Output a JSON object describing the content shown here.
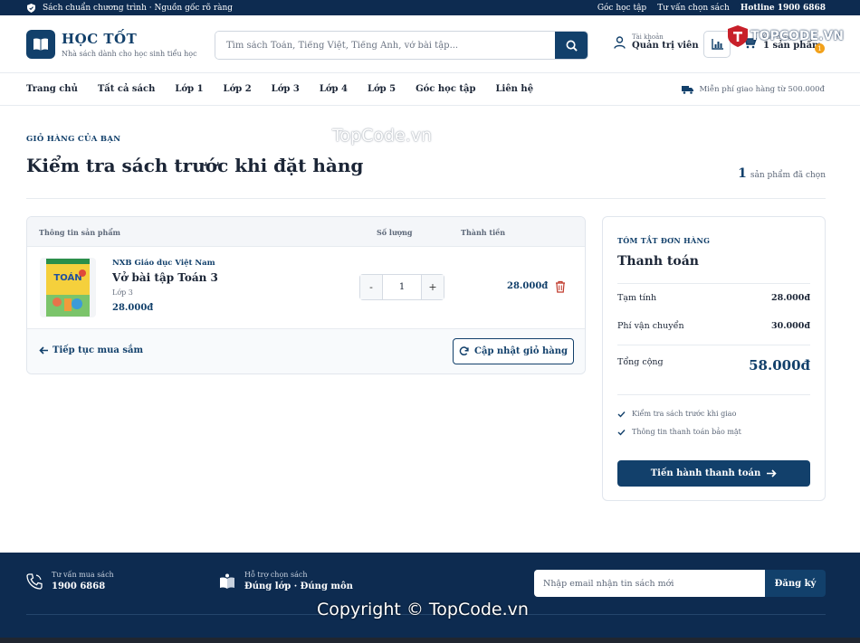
{
  "topbar": {
    "tagline": "Sách chuẩn chương trình · Nguồn gốc rõ ràng",
    "links": [
      "Góc học tập",
      "Tư vấn chọn sách",
      "Hotline 1900 6868"
    ]
  },
  "brand": {
    "name": "HỌC TỐT",
    "slogan": "Nhà sách dành cho học sinh tiểu học",
    "color": "#12406b"
  },
  "search": {
    "placeholder": "Tìm sách Toán, Tiếng Việt, Tiếng Anh, vở bài tập..."
  },
  "account": {
    "label": "Tài khoản",
    "name": "Quản trị viên"
  },
  "cart_widget": {
    "label": "Giỏ hàng",
    "count_text": "1 sản phẩm",
    "badge": "1"
  },
  "watermark": {
    "brand": "TOPCODE.VN",
    "text1": "TopCode.vn",
    "text2": "Copyright © TopCode.vn"
  },
  "nav": {
    "items": [
      "Trang chủ",
      "Tất cả sách",
      "Lớp 1",
      "Lớp 2",
      "Lớp 3",
      "Lớp 4",
      "Lớp 5",
      "Góc học tập",
      "Liên hệ"
    ],
    "shipping": "Miễn phí giao hàng từ 500.000đ"
  },
  "page": {
    "eyebrow": "GIỎ HÀNG CỦA BẠN",
    "title": "Kiểm tra sách trước khi đặt hàng",
    "count_num": "1",
    "count_label": "sản phẩm đã chọn"
  },
  "cart": {
    "headers": {
      "product": "Thông tin sản phẩm",
      "qty": "Số lượng",
      "total": "Thành tiền"
    },
    "items": [
      {
        "publisher": "NXB Giáo dục Việt Nam",
        "name": "Vở bài tập Toán 3",
        "grade": "Lớp 3",
        "price": "28.000đ",
        "cover_text": "TOÁN",
        "quantity": "1",
        "line_total": "28.000đ"
      }
    ],
    "continue_label": "Tiếp tục mua sắm",
    "update_label": "Cập nhật giỏ hàng"
  },
  "summary": {
    "eyebrow": "TÓM TẮT ĐƠN HÀNG",
    "title": "Thanh toán",
    "subtotal_label": "Tạm tính",
    "subtotal": "28.000đ",
    "shipping_label": "Phí vận chuyển",
    "shipping": "30.000đ",
    "total_label": "Tổng cộng",
    "total": "58.000đ",
    "notes": [
      "Kiểm tra sách trước khi giao",
      "Thông tin thanh toán bảo mật"
    ],
    "checkout_label": "Tiến hành thanh toán"
  },
  "footer": {
    "consult_label": "Tư vấn mua sách",
    "consult_value": "1900 6868",
    "support_label": "Hỗ trợ chọn sách",
    "support_value": "Đúng lớp · Đúng môn",
    "email_placeholder": "Nhập email nhận tin sách mới",
    "subscribe_label": "Đăng ký"
  }
}
